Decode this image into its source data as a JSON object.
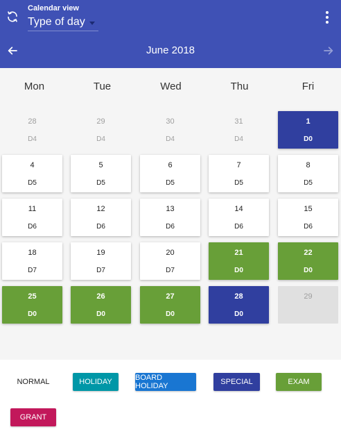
{
  "header": {
    "icon": "sync-icon",
    "caption": "Calendar view",
    "view_value": "Type of day",
    "more_icon": "more-vert-icon",
    "color": "#3f51b5"
  },
  "nav": {
    "prev_icon": "arrow-left-icon",
    "next_icon": "arrow-right-icon",
    "month": "June 2018"
  },
  "calendar": {
    "weekdays": [
      "Mon",
      "Tue",
      "Wed",
      "Thu",
      "Fri"
    ],
    "weeks": [
      [
        {
          "day": "28",
          "code": "D4",
          "type": "muted"
        },
        {
          "day": "29",
          "code": "D4",
          "type": "muted"
        },
        {
          "day": "30",
          "code": "D4",
          "type": "muted"
        },
        {
          "day": "31",
          "code": "D4",
          "type": "muted"
        },
        {
          "day": "1",
          "code": "D0",
          "type": "special"
        }
      ],
      [
        {
          "day": "4",
          "code": "D5",
          "type": "normal"
        },
        {
          "day": "5",
          "code": "D5",
          "type": "normal"
        },
        {
          "day": "6",
          "code": "D5",
          "type": "normal"
        },
        {
          "day": "7",
          "code": "D5",
          "type": "normal"
        },
        {
          "day": "8",
          "code": "D5",
          "type": "normal"
        }
      ],
      [
        {
          "day": "11",
          "code": "D6",
          "type": "normal"
        },
        {
          "day": "12",
          "code": "D6",
          "type": "normal"
        },
        {
          "day": "13",
          "code": "D6",
          "type": "normal"
        },
        {
          "day": "14",
          "code": "D6",
          "type": "normal"
        },
        {
          "day": "15",
          "code": "D6",
          "type": "normal"
        }
      ],
      [
        {
          "day": "18",
          "code": "D7",
          "type": "normal"
        },
        {
          "day": "19",
          "code": "D7",
          "type": "normal"
        },
        {
          "day": "20",
          "code": "D7",
          "type": "normal"
        },
        {
          "day": "21",
          "code": "D0",
          "type": "exam"
        },
        {
          "day": "22",
          "code": "D0",
          "type": "exam"
        }
      ],
      [
        {
          "day": "25",
          "code": "D0",
          "type": "exam"
        },
        {
          "day": "26",
          "code": "D0",
          "type": "exam"
        },
        {
          "day": "27",
          "code": "D0",
          "type": "exam"
        },
        {
          "day": "28",
          "code": "D0",
          "type": "special"
        },
        {
          "day": "29",
          "code": "",
          "type": "disabled"
        }
      ]
    ]
  },
  "legend": {
    "items": [
      {
        "label": "NORMAL",
        "color": "#ffffff",
        "text_color": "#222222"
      },
      {
        "label": "HOLIDAY",
        "color": "#0097a7",
        "text_color": "#ffffff"
      },
      {
        "label": "BOARD HOLIDAY",
        "color": "#1976d2",
        "text_color": "#ffffff"
      },
      {
        "label": "SPECIAL",
        "color": "#303f9f",
        "text_color": "#ffffff"
      },
      {
        "label": "EXAM",
        "color": "#689f38",
        "text_color": "#ffffff"
      },
      {
        "label": "GRANT",
        "color": "#c2185b",
        "text_color": "#ffffff"
      }
    ]
  }
}
